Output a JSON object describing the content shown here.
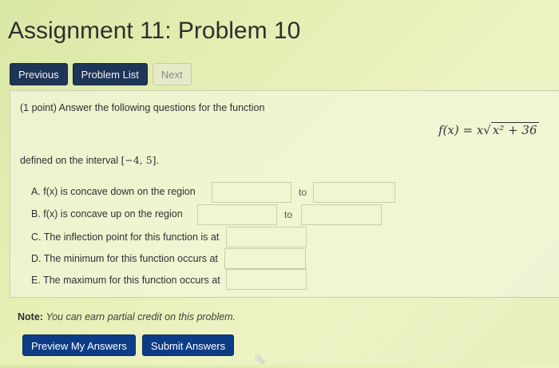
{
  "page": {
    "title": "Assignment 11: Problem 10"
  },
  "nav": {
    "previous": "Previous",
    "problem_list": "Problem List",
    "next": "Next"
  },
  "problem": {
    "intro": "(1 point) Answer the following questions for the function",
    "formula_lhs": "f(x) = x",
    "formula_sqrt": "x² + 36",
    "interval_prefix": "defined on the interval ",
    "interval": "[−4, 5]",
    "interval_suffix": ".",
    "questions": [
      {
        "label": "A. f(x) is concave down on the region",
        "to": "to"
      },
      {
        "label": "B. f(x) is concave up on the region",
        "to": "to"
      },
      {
        "label": "C. The inflection point for this function is at"
      },
      {
        "label": "D. The minimum for this function occurs at"
      },
      {
        "label": "E. The maximum for this function occurs at"
      }
    ]
  },
  "note": {
    "label": "Note:",
    "text": "You can earn partial credit on this problem."
  },
  "actions": {
    "preview": "Preview My Answers",
    "submit": "Submit Answers"
  }
}
